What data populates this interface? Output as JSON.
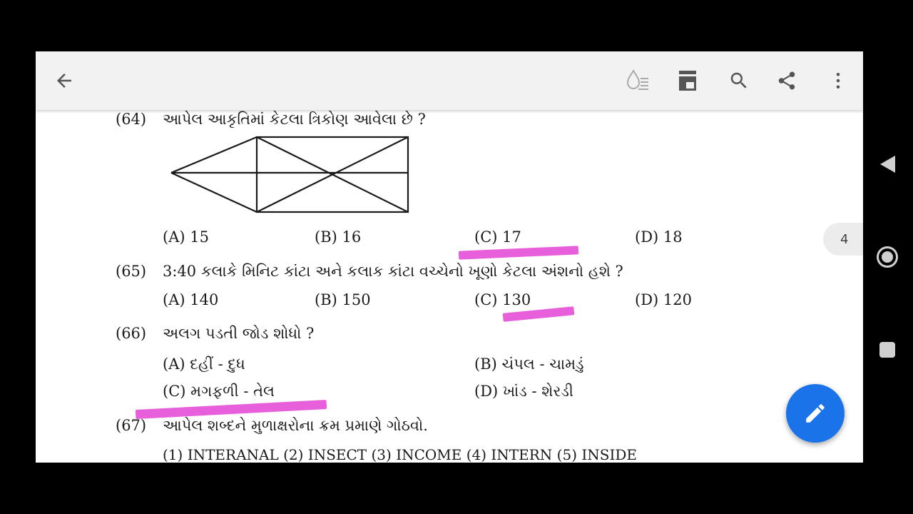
{
  "page_indicator": "4",
  "colors": {
    "highlight": "#e656d9",
    "fab": "#1a73e8",
    "toolbar": "#f2f2f2"
  },
  "toolbar": {
    "icons": [
      "back-arrow-icon",
      "reading-mode-icon",
      "page-layout-icon",
      "search-icon",
      "share-icon",
      "more-vert-icon"
    ]
  },
  "questions": {
    "q64": {
      "number": "(64)",
      "text": "આપેલ આકૃતિમાં કેટલા ત્રિકોણ આવેલા છે ?",
      "options": [
        "(A) 15",
        "(B) 16",
        "(C) 17",
        "(D) 18"
      ]
    },
    "q65": {
      "number": "(65)",
      "text": "3:40 કલાકે મિનિટ કાંટા અને કલાક કાંટા વચ્ચેનો ખૂણો કેટલા અંશનો હશે ?",
      "options": [
        "(A) 140",
        "(B) 150",
        "(C) 130",
        "(D) 120"
      ]
    },
    "q66": {
      "number": "(66)",
      "text": "અલગ પડતી જોડ શોધો ?",
      "options": [
        "(A) દહીં - દુધ",
        "(B) ચંપલ - ચામડું",
        "(C) મગફળી - તેલ",
        "(D) ખાંડ - શેરડી"
      ]
    },
    "q67": {
      "number": "(67)",
      "text": "આપેલ શબ્દને મુળાક્ષરોના ક્રમ પ્રમાણે ગોઠવો.",
      "words": "(1) INTERANAL (2) INSECT (3) INCOME (4) INTERN (5) INSIDE"
    }
  },
  "nav_bar": {
    "icons": [
      "nav-back-icon",
      "nav-home-icon",
      "nav-recents-icon"
    ]
  }
}
